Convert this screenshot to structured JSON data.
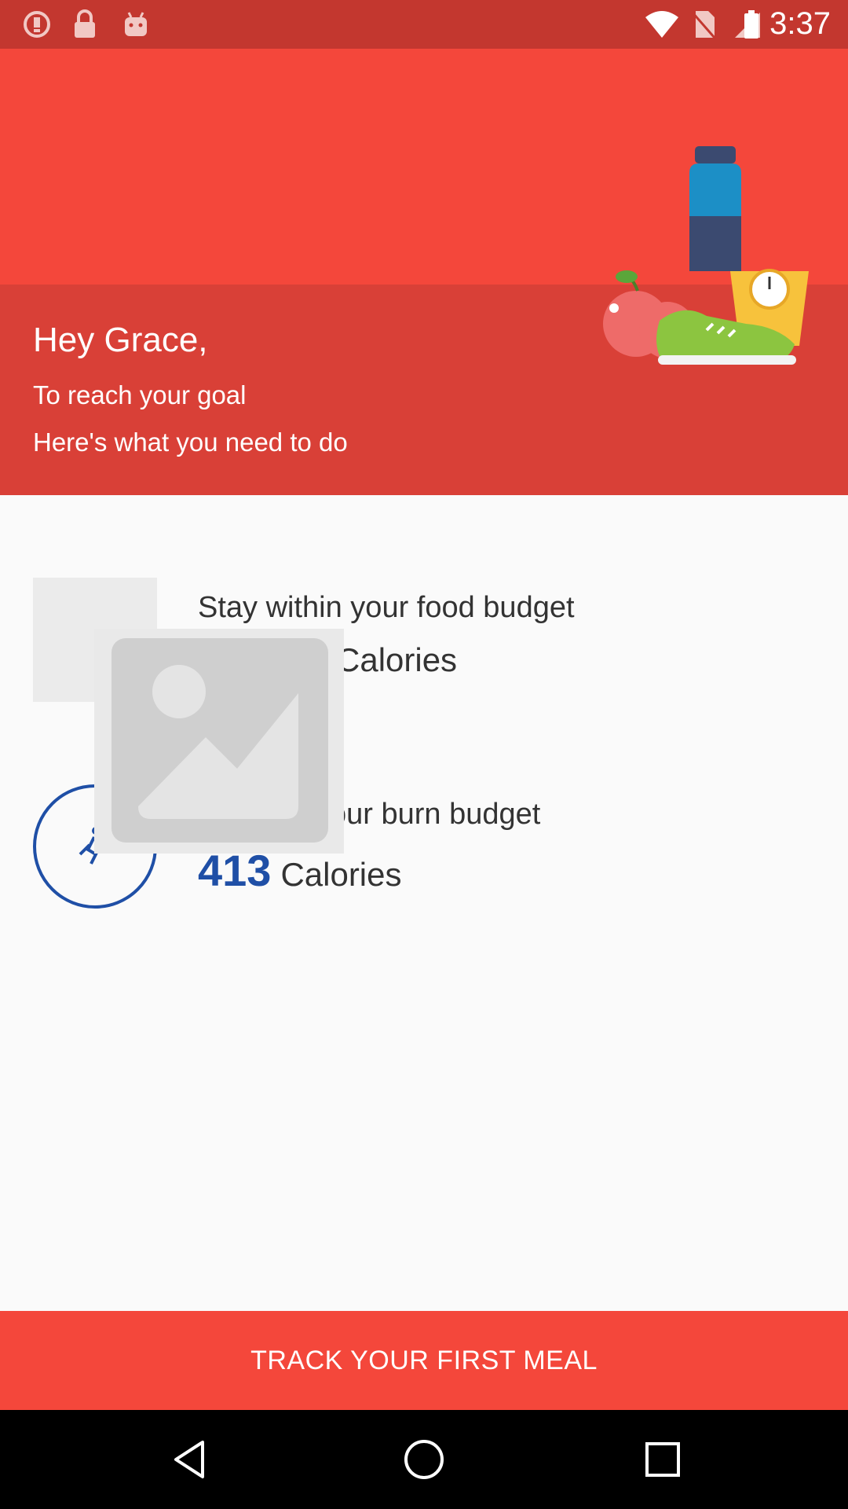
{
  "status_bar": {
    "time": "3:37",
    "left_icons": [
      "alert-icon",
      "lock-icon",
      "android-icon"
    ],
    "right_icons": [
      "wifi-icon",
      "no-sim-icon",
      "signal-icon",
      "battery-icon"
    ]
  },
  "header": {
    "greeting": "Hey Grace,",
    "line1": "To reach your goal",
    "line2": "Here's what you need to do",
    "illustration_icon": "bottle-apple-shoe-scale-icon"
  },
  "food": {
    "title": "Stay within your food budget",
    "calories_unit": "Calories",
    "icon": "food-placeholder-icon"
  },
  "burn": {
    "title": "our burn budget",
    "calories_value": "413",
    "calories_unit": "Calories",
    "icon": "running-icon"
  },
  "overlay": {
    "icon": "image-placeholder-icon"
  },
  "cta": {
    "label": "TRACK YOUR FIRST MEAL"
  },
  "nav": {
    "icons": [
      "back-icon",
      "home-icon",
      "recents-icon"
    ]
  },
  "colors": {
    "status_bar": "#c3372f",
    "hero_top": "#f4473b",
    "hero_bottom": "#d94037",
    "accent_blue": "#1f4fa6",
    "cta": "#f4473b"
  }
}
